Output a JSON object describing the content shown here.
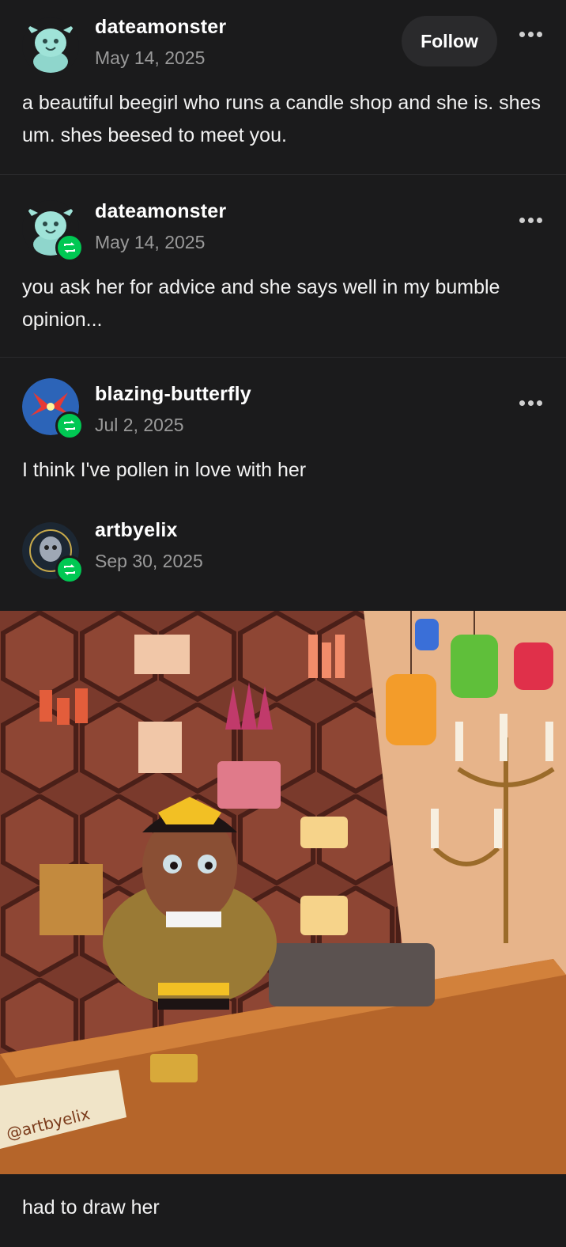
{
  "posts": [
    {
      "username": "dateamonster",
      "date": "May 14, 2025",
      "text": "a beautiful beegirl who runs a candle shop and she is. shes um. shes beesed to meet you.",
      "follow_label": "Follow"
    },
    {
      "username": "dateamonster",
      "date": "May 14, 2025",
      "text": "you ask her for advice and she says well in my bumble opinion..."
    },
    {
      "username": "blazing-butterfly",
      "date": "Jul 2, 2025",
      "text": "I think I've pollen in love with her"
    },
    {
      "username": "artbyelix",
      "date": "Sep 30, 2025",
      "caption": "had to draw her",
      "signature": "@artbyelix"
    }
  ],
  "colors": {
    "background": "#1b1b1c",
    "reblog_badge": "#00c853",
    "date_text": "#9a9a9a"
  },
  "icons": {
    "more": "more-horizontal-icon",
    "reblog": "reblog-icon"
  }
}
